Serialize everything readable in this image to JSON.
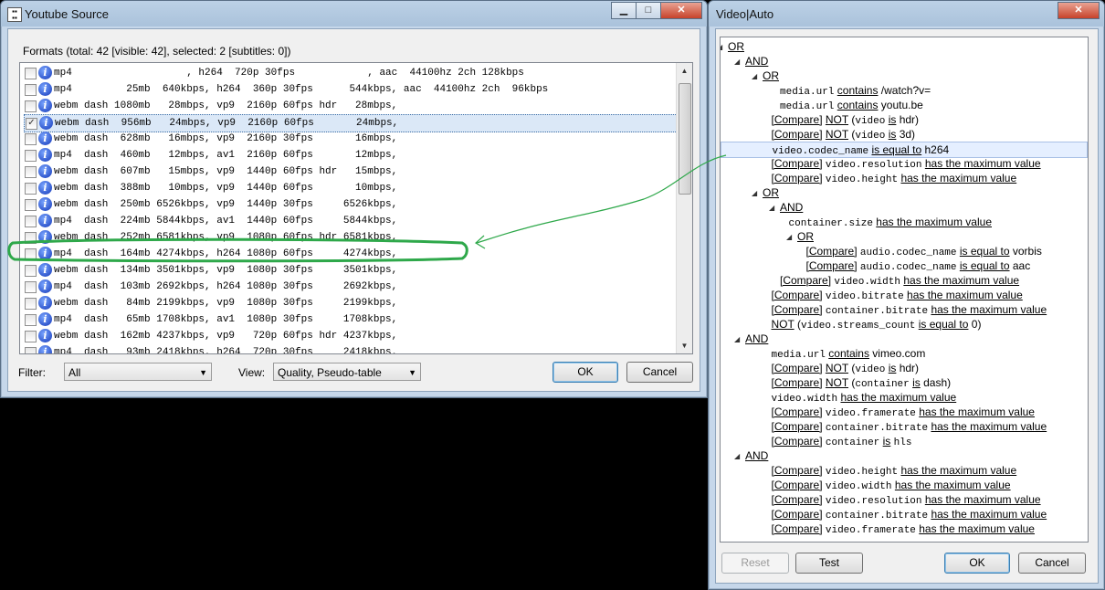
{
  "left_window": {
    "title": "Youtube Source",
    "caption_buttons": [
      "minimize",
      "maximize",
      "close"
    ],
    "formats_header": "Formats (total: 42 [visible: 42], selected: 2 [subtitles: 0])",
    "formats": [
      {
        "checked": false,
        "text": "mp4                   , h264  720p 30fps            , aac  44100hz 2ch 128kbps"
      },
      {
        "checked": false,
        "text": "mp4         25mb  640kbps, h264  360p 30fps      544kbps, aac  44100hz 2ch  96kbps"
      },
      {
        "checked": false,
        "text": "webm dash 1080mb   28mbps, vp9  2160p 60fps hdr   28mbps,"
      },
      {
        "checked": true,
        "text": "webm dash  956mb   24mbps, vp9  2160p 60fps       24mbps,"
      },
      {
        "checked": false,
        "text": "webm dash  628mb   16mbps, vp9  2160p 30fps       16mbps,"
      },
      {
        "checked": false,
        "text": "mp4  dash  460mb   12mbps, av1  2160p 60fps       12mbps,"
      },
      {
        "checked": false,
        "text": "webm dash  607mb   15mbps, vp9  1440p 60fps hdr   15mbps,"
      },
      {
        "checked": false,
        "text": "webm dash  388mb   10mbps, vp9  1440p 60fps       10mbps,"
      },
      {
        "checked": false,
        "text": "webm dash  250mb 6526kbps, vp9  1440p 30fps     6526kbps,"
      },
      {
        "checked": false,
        "text": "mp4  dash  224mb 5844kbps, av1  1440p 60fps     5844kbps,"
      },
      {
        "checked": false,
        "text": "webm dash  252mb 6581kbps, vp9  1080p 60fps hdr 6581kbps,"
      },
      {
        "checked": false,
        "text": "mp4  dash  164mb 4274kbps, h264 1080p 60fps     4274kbps,"
      },
      {
        "checked": false,
        "text": "webm dash  134mb 3501kbps, vp9  1080p 30fps     3501kbps,"
      },
      {
        "checked": false,
        "text": "mp4  dash  103mb 2692kbps, h264 1080p 30fps     2692kbps,"
      },
      {
        "checked": false,
        "text": "webm dash   84mb 2199kbps, vp9  1080p 30fps     2199kbps,"
      },
      {
        "checked": false,
        "text": "mp4  dash   65mb 1708kbps, av1  1080p 30fps     1708kbps,"
      },
      {
        "checked": false,
        "text": "webm dash  162mb 4237kbps, vp9   720p 60fps hdr 4237kbps,"
      },
      {
        "checked": false,
        "text": "mp4  dash   93mb 2418kbps, h264  720p 30fps     2418kbps,"
      }
    ],
    "filter_label": "Filter:",
    "filter_value": "All",
    "view_label": "View:",
    "view_value": "Quality, Pseudo-table",
    "ok_label": "OK",
    "cancel_label": "Cancel"
  },
  "right_window": {
    "title": "Video|Auto",
    "close_glyph": "✕",
    "tree": [
      {
        "level": 0,
        "expand": true,
        "parts": [
          {
            "t": "OR",
            "u": true
          }
        ]
      },
      {
        "level": 1,
        "expand": true,
        "parts": [
          {
            "t": "AND",
            "u": true
          }
        ]
      },
      {
        "level": 2,
        "expand": true,
        "parts": [
          {
            "t": "OR",
            "u": true
          }
        ]
      },
      {
        "level": 3,
        "parts": [
          {
            "t": "media.url",
            "m": true
          },
          {
            "t": " "
          },
          {
            "t": "contains",
            "u": true
          },
          {
            "t": " /watch?v="
          }
        ]
      },
      {
        "level": 3,
        "parts": [
          {
            "t": "media.url",
            "m": true
          },
          {
            "t": " "
          },
          {
            "t": "contains",
            "u": true
          },
          {
            "t": " youtu.be"
          }
        ]
      },
      {
        "level": 2.5,
        "parts": [
          {
            "t": "[Compare]",
            "u": true
          },
          {
            "t": " "
          },
          {
            "t": "NOT",
            "u": true
          },
          {
            "t": " ("
          },
          {
            "t": "video",
            "m": true
          },
          {
            "t": " "
          },
          {
            "t": "is",
            "u": true
          },
          {
            "t": " hdr)"
          }
        ]
      },
      {
        "level": 2.5,
        "parts": [
          {
            "t": "[Compare]",
            "u": true
          },
          {
            "t": " "
          },
          {
            "t": "NOT",
            "u": true
          },
          {
            "t": " ("
          },
          {
            "t": "video",
            "m": true
          },
          {
            "t": " "
          },
          {
            "t": "is",
            "u": true
          },
          {
            "t": " 3d)"
          }
        ]
      },
      {
        "level": 2.5,
        "hl": true,
        "parts": [
          {
            "t": "video.codec_name",
            "m": true
          },
          {
            "t": " "
          },
          {
            "t": "is equal to",
            "u": true
          },
          {
            "t": " h264"
          }
        ]
      },
      {
        "level": 2.5,
        "parts": [
          {
            "t": "[Compare]",
            "u": true
          },
          {
            "t": " "
          },
          {
            "t": "video.resolution",
            "m": true
          },
          {
            "t": " "
          },
          {
            "t": "has the maximum value",
            "u": true
          }
        ]
      },
      {
        "level": 2.5,
        "parts": [
          {
            "t": "[Compare]",
            "u": true
          },
          {
            "t": " "
          },
          {
            "t": "video.height",
            "m": true
          },
          {
            "t": " "
          },
          {
            "t": "has the maximum value",
            "u": true
          }
        ]
      },
      {
        "level": 2,
        "expand": true,
        "parts": [
          {
            "t": "OR",
            "u": true
          }
        ]
      },
      {
        "level": 3,
        "expand": true,
        "parts": [
          {
            "t": "AND",
            "u": true
          }
        ]
      },
      {
        "level": 3.5,
        "parts": [
          {
            "t": "container.size",
            "m": true
          },
          {
            "t": " "
          },
          {
            "t": "has the maximum value",
            "u": true
          }
        ]
      },
      {
        "level": 4,
        "expand": true,
        "parts": [
          {
            "t": "OR",
            "u": true
          }
        ]
      },
      {
        "level": 4.5,
        "parts": [
          {
            "t": "[Compare]",
            "u": true
          },
          {
            "t": " "
          },
          {
            "t": "audio.codec_name",
            "m": true
          },
          {
            "t": " "
          },
          {
            "t": "is equal to",
            "u": true
          },
          {
            "t": " vorbis"
          }
        ]
      },
      {
        "level": 4.5,
        "parts": [
          {
            "t": "[Compare]",
            "u": true
          },
          {
            "t": " "
          },
          {
            "t": "audio.codec_name",
            "m": true
          },
          {
            "t": " "
          },
          {
            "t": "is equal to",
            "u": true
          },
          {
            "t": " aac"
          }
        ]
      },
      {
        "level": 3,
        "parts": [
          {
            "t": "[Compare]",
            "u": true
          },
          {
            "t": " "
          },
          {
            "t": "video.width",
            "m": true
          },
          {
            "t": " "
          },
          {
            "t": "has the maximum value",
            "u": true
          }
        ]
      },
      {
        "level": 2.5,
        "parts": [
          {
            "t": "[Compare]",
            "u": true
          },
          {
            "t": " "
          },
          {
            "t": "video.bitrate",
            "m": true
          },
          {
            "t": " "
          },
          {
            "t": "has the maximum value",
            "u": true
          }
        ]
      },
      {
        "level": 2.5,
        "parts": [
          {
            "t": "[Compare]",
            "u": true
          },
          {
            "t": " "
          },
          {
            "t": "container.bitrate",
            "m": true
          },
          {
            "t": " "
          },
          {
            "t": "has the maximum value",
            "u": true
          }
        ]
      },
      {
        "level": 2.5,
        "parts": [
          {
            "t": "NOT",
            "u": true
          },
          {
            "t": " ("
          },
          {
            "t": "video.streams_count",
            "m": true
          },
          {
            "t": " "
          },
          {
            "t": "is equal to",
            "u": true
          },
          {
            "t": " 0)"
          }
        ]
      },
      {
        "level": 1,
        "expand": true,
        "parts": [
          {
            "t": "AND",
            "u": true
          }
        ]
      },
      {
        "level": 2.5,
        "parts": [
          {
            "t": "media.url",
            "m": true
          },
          {
            "t": " "
          },
          {
            "t": "contains",
            "u": true
          },
          {
            "t": " vimeo.com"
          }
        ]
      },
      {
        "level": 2.5,
        "parts": [
          {
            "t": "[Compare]",
            "u": true
          },
          {
            "t": " "
          },
          {
            "t": "NOT",
            "u": true
          },
          {
            "t": " ("
          },
          {
            "t": "video",
            "m": true
          },
          {
            "t": " "
          },
          {
            "t": "is",
            "u": true
          },
          {
            "t": " hdr)"
          }
        ]
      },
      {
        "level": 2.5,
        "parts": [
          {
            "t": "[Compare]",
            "u": true
          },
          {
            "t": " "
          },
          {
            "t": "NOT",
            "u": true
          },
          {
            "t": " ("
          },
          {
            "t": "container",
            "m": true
          },
          {
            "t": " "
          },
          {
            "t": "is",
            "u": true
          },
          {
            "t": " dash)"
          }
        ]
      },
      {
        "level": 2.5,
        "parts": [
          {
            "t": "video.width",
            "m": true
          },
          {
            "t": " "
          },
          {
            "t": "has the maximum value",
            "u": true
          }
        ]
      },
      {
        "level": 2.5,
        "parts": [
          {
            "t": "[Compare]",
            "u": true
          },
          {
            "t": " "
          },
          {
            "t": "video.framerate",
            "m": true
          },
          {
            "t": " "
          },
          {
            "t": "has the maximum value",
            "u": true
          }
        ]
      },
      {
        "level": 2.5,
        "parts": [
          {
            "t": "[Compare]",
            "u": true
          },
          {
            "t": " "
          },
          {
            "t": "container.bitrate",
            "m": true
          },
          {
            "t": " "
          },
          {
            "t": "has the maximum value",
            "u": true
          }
        ]
      },
      {
        "level": 2.5,
        "parts": [
          {
            "t": "[Compare]",
            "u": true
          },
          {
            "t": " "
          },
          {
            "t": "container",
            "m": true
          },
          {
            "t": " "
          },
          {
            "t": "is",
            "u": true
          },
          {
            "t": " "
          },
          {
            "t": "hls",
            "m": true
          }
        ]
      },
      {
        "level": 1,
        "expand": true,
        "parts": [
          {
            "t": "AND",
            "u": true
          }
        ]
      },
      {
        "level": 2.5,
        "parts": [
          {
            "t": "[Compare]",
            "u": true
          },
          {
            "t": " "
          },
          {
            "t": "video.height",
            "m": true
          },
          {
            "t": " "
          },
          {
            "t": "has the maximum value",
            "u": true
          }
        ]
      },
      {
        "level": 2.5,
        "parts": [
          {
            "t": "[Compare]",
            "u": true
          },
          {
            "t": " "
          },
          {
            "t": "video.width",
            "m": true
          },
          {
            "t": " "
          },
          {
            "t": "has the maximum value",
            "u": true
          }
        ]
      },
      {
        "level": 2.5,
        "parts": [
          {
            "t": "[Compare]",
            "u": true
          },
          {
            "t": " "
          },
          {
            "t": "video.resolution",
            "m": true
          },
          {
            "t": " "
          },
          {
            "t": "has the maximum value",
            "u": true
          }
        ]
      },
      {
        "level": 2.5,
        "parts": [
          {
            "t": "[Compare]",
            "u": true
          },
          {
            "t": " "
          },
          {
            "t": "container.bitrate",
            "m": true
          },
          {
            "t": " "
          },
          {
            "t": "has the maximum value",
            "u": true
          }
        ]
      },
      {
        "level": 2.5,
        "parts": [
          {
            "t": "[Compare]",
            "u": true
          },
          {
            "t": " "
          },
          {
            "t": "video.framerate",
            "m": true
          },
          {
            "t": " "
          },
          {
            "t": "has the maximum value",
            "u": true
          }
        ]
      }
    ],
    "reset_label": "Reset",
    "test_label": "Test",
    "ok_label": "OK",
    "cancel_label": "Cancel"
  },
  "annotation": {
    "color": "#2ea84a",
    "highlighted_row_index": 11
  }
}
